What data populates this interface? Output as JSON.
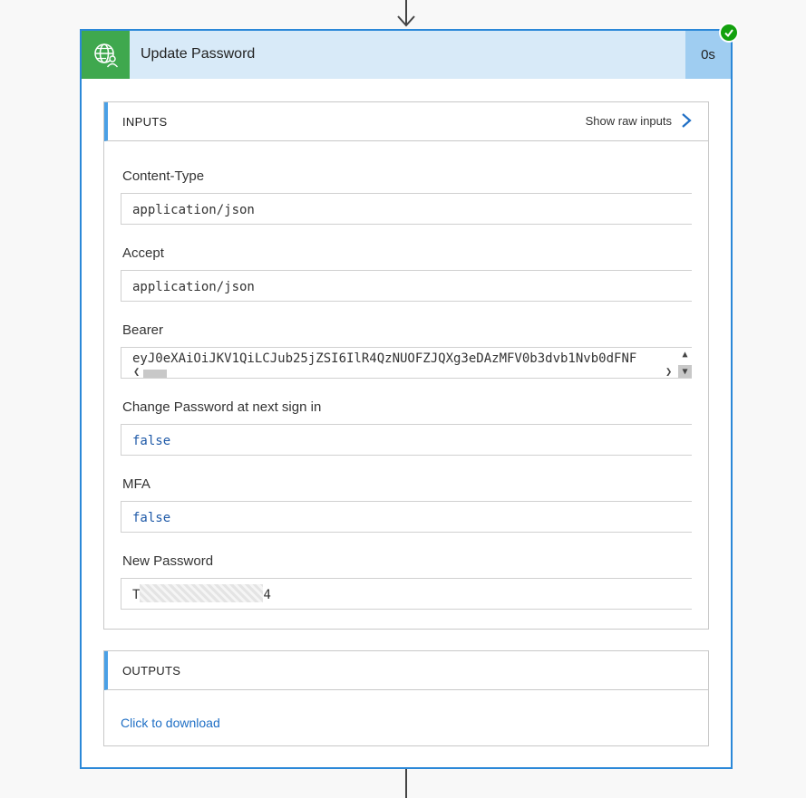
{
  "card": {
    "title": "Update Password",
    "duration": "0s",
    "icon": "globe-user-icon",
    "status": "succeeded",
    "colors": {
      "accent": "#2b88d8",
      "icon_bg": "#3fa84e",
      "header_bg": "#d8eaf8",
      "duration_bg": "#9fcdf1",
      "success": "#13a10e"
    }
  },
  "inputs": {
    "title": "INPUTS",
    "raw_link": "Show raw inputs",
    "fields": [
      {
        "label": "Content-Type",
        "value": "application/json"
      },
      {
        "label": "Accept",
        "value": "application/json"
      },
      {
        "label": "Bearer",
        "value": "eyJ0eXAiOiJKV1QiLCJub25jZSI6IlR4QzNUOFZJQXg3eDAzMFV0b3dvb1Nvb0dFNF"
      },
      {
        "label": "Change Password at next sign in",
        "value": "false"
      },
      {
        "label": "MFA",
        "value": "false"
      },
      {
        "label": "New Password",
        "value_start": "T",
        "value_end": "4"
      }
    ]
  },
  "outputs": {
    "title": "OUTPUTS",
    "download_link": "Click to download"
  }
}
